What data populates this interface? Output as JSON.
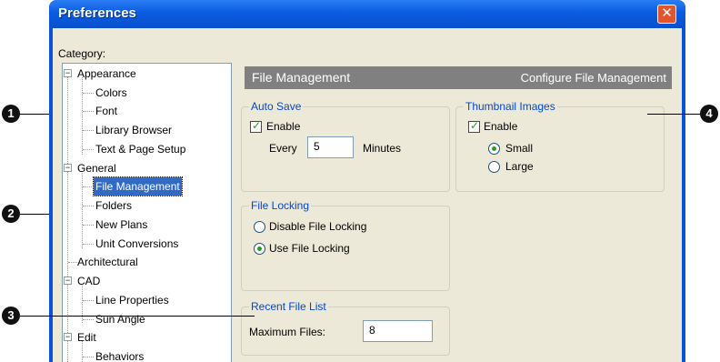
{
  "window": {
    "title": "Preferences",
    "close_glyph": "✕"
  },
  "category": {
    "label": "Category:",
    "tree": [
      {
        "label": "Appearance",
        "expander": "−"
      },
      {
        "label": "Colors"
      },
      {
        "label": "Font"
      },
      {
        "label": "Library Browser"
      },
      {
        "label": "Text & Page Setup"
      },
      {
        "label": "General",
        "expander": "−"
      },
      {
        "label": "File Management",
        "selected": true
      },
      {
        "label": "Folders"
      },
      {
        "label": "New Plans"
      },
      {
        "label": "Unit Conversions"
      },
      {
        "label": "Architectural"
      },
      {
        "label": "CAD",
        "expander": "−"
      },
      {
        "label": "Line Properties"
      },
      {
        "label": "Sun Angle"
      },
      {
        "label": "Edit",
        "expander": "−"
      },
      {
        "label": "Behaviors"
      }
    ]
  },
  "panel": {
    "title": "File Management",
    "subtitle": "Configure File Management"
  },
  "auto_save": {
    "legend": "Auto Save",
    "enable_label": "Enable",
    "enabled": true,
    "every_label": "Every",
    "minutes_value": "5",
    "minutes_label": "Minutes"
  },
  "thumbnail_images": {
    "legend": "Thumbnail Images",
    "enable_label": "Enable",
    "enabled": true,
    "options": [
      "Small",
      "Large"
    ],
    "selected": "Small"
  },
  "file_locking": {
    "legend": "File Locking",
    "options": [
      "Disable File Locking",
      "Use File Locking"
    ],
    "selected": "Use File Locking"
  },
  "recent_file_list": {
    "legend": "Recent File List",
    "max_files_label": "Maximum Files:",
    "max_files_value": "8"
  },
  "callouts": [
    "1",
    "2",
    "3",
    "4"
  ],
  "colors": {
    "titlebar": "#0a5ce0",
    "selection": "#316ac5",
    "group_legend": "#0046d5",
    "header": "#808080"
  }
}
